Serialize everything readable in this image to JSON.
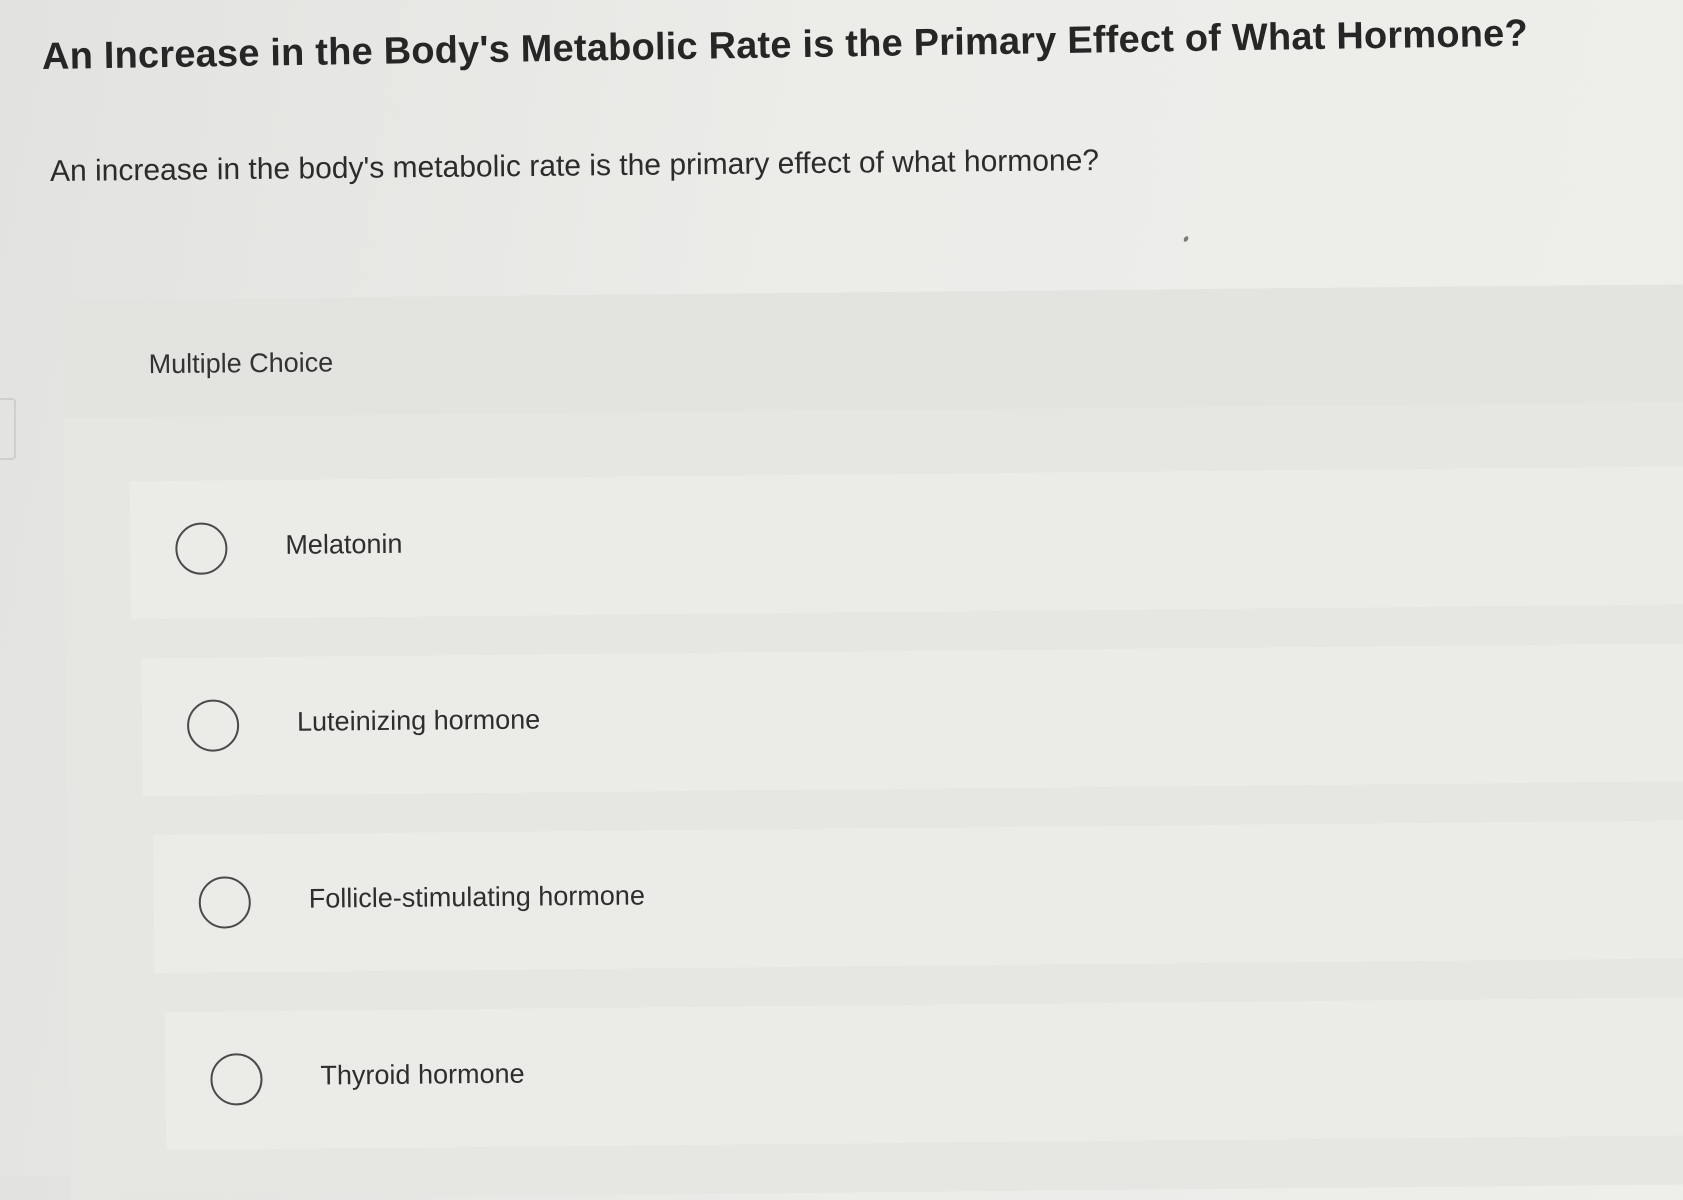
{
  "question": {
    "title": "An Increase in the Body's Metabolic Rate is the Primary Effect of What Hormone?",
    "prompt": "An increase in the body's metabolic rate is the primary effect of what hormone?"
  },
  "choice_panel": {
    "label": "Multiple Choice",
    "options": [
      {
        "label": "Melatonin",
        "selected": false
      },
      {
        "label": "Luteinizing hormone",
        "selected": false
      },
      {
        "label": "Follicle-stimulating hormone",
        "selected": false
      },
      {
        "label": "Thyroid hormone",
        "selected": false
      }
    ]
  },
  "colors": {
    "background": "#ecece9",
    "text": "#2a2a2a",
    "radio_border": "#4a4a4a"
  }
}
